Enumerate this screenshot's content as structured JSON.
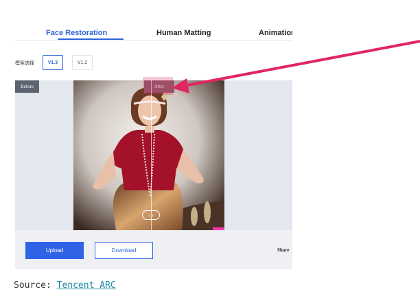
{
  "tabs": [
    {
      "label": "Face Restoration",
      "active": true
    },
    {
      "label": "Human Matting",
      "active": false
    },
    {
      "label": "Animation",
      "active": false
    }
  ],
  "model": {
    "label": "模型选择",
    "versions": [
      {
        "label": "V1.3",
        "selected": true
      },
      {
        "label": "V1.2",
        "selected": false
      }
    ]
  },
  "compare": {
    "before_label": "Before",
    "after_label": "After",
    "image_description": "Smiling woman wearing a red top, pearl necklaces, a headband with feathers and a gold skirt",
    "handle_icon": "left-right-arrows-icon"
  },
  "actions": {
    "upload_label": "Upload",
    "download_label": "Download",
    "share_label": "Share"
  },
  "source": {
    "prefix": "Source:",
    "link_text": "Tencent ARC"
  },
  "colors": {
    "accent": "#2f63e6",
    "annotation_arrow": "#e02663",
    "panel_bg": "#e3e7ee"
  }
}
